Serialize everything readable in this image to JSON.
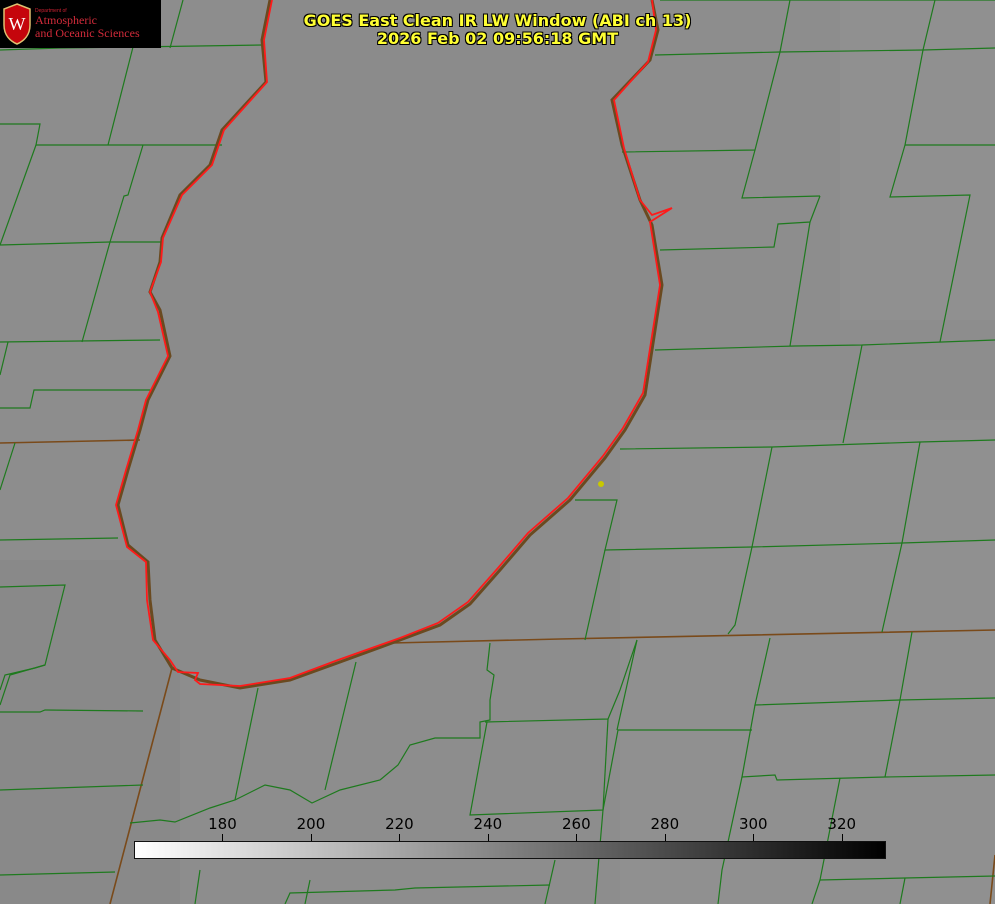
{
  "title": {
    "line1": "GOES East Clean IR LW Window (ABI ch 13)",
    "line2": "2026 Feb 02 09:56:18 GMT"
  },
  "logo": {
    "department": "Department of",
    "line1": "Atmospheric",
    "line2": "and Oceanic Sciences",
    "seal_letter": "W"
  },
  "colorbar": {
    "min": 160,
    "max": 330,
    "ticks": [
      "180",
      "200",
      "220",
      "240",
      "260",
      "280",
      "300",
      "320"
    ],
    "colormap": "white-to-black"
  },
  "colors": {
    "background": "#8c8c8c",
    "lake": "#8a8a8a",
    "county_lines": "#1e7a1e",
    "state_lines": "#8b4513",
    "coastline": "#ff1a1a",
    "title_text": "#ffff33",
    "marker": "#c8c800"
  }
}
